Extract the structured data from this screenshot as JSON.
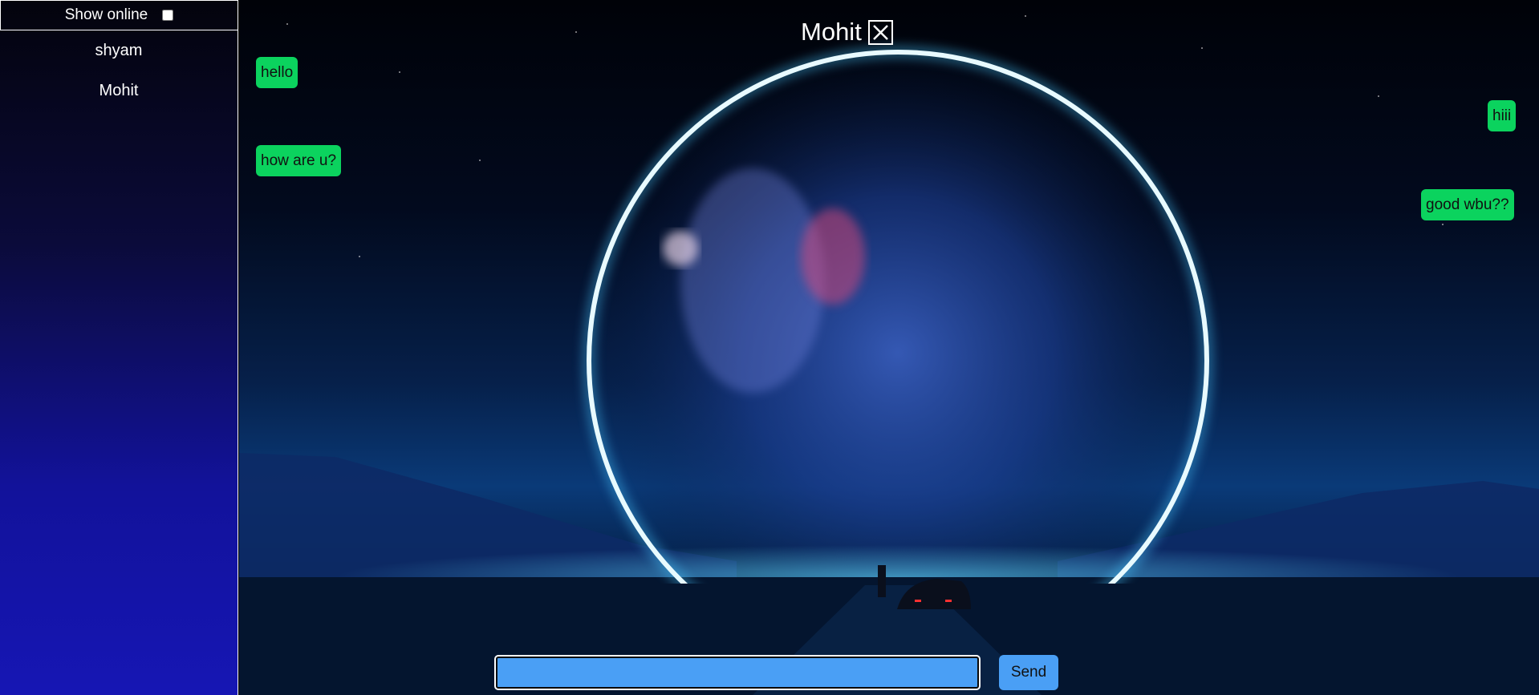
{
  "sidebar": {
    "show_online_label": "Show online",
    "show_online_checked": false,
    "users": [
      {
        "name": "shyam"
      },
      {
        "name": "Mohit"
      }
    ]
  },
  "chat": {
    "title": "Mohit",
    "close_icon": "close-icon",
    "messages": [
      {
        "text": "hello",
        "side": "left"
      },
      {
        "text": "hiii",
        "side": "right"
      },
      {
        "text": "how are u?",
        "side": "left"
      },
      {
        "text": "good wbu??",
        "side": "right"
      }
    ],
    "input_value": "",
    "send_label": "Send"
  },
  "colors": {
    "message_bubble": "#0bd35e",
    "input_bg": "#4a9ff5",
    "send_button": "#4a9ff5"
  }
}
